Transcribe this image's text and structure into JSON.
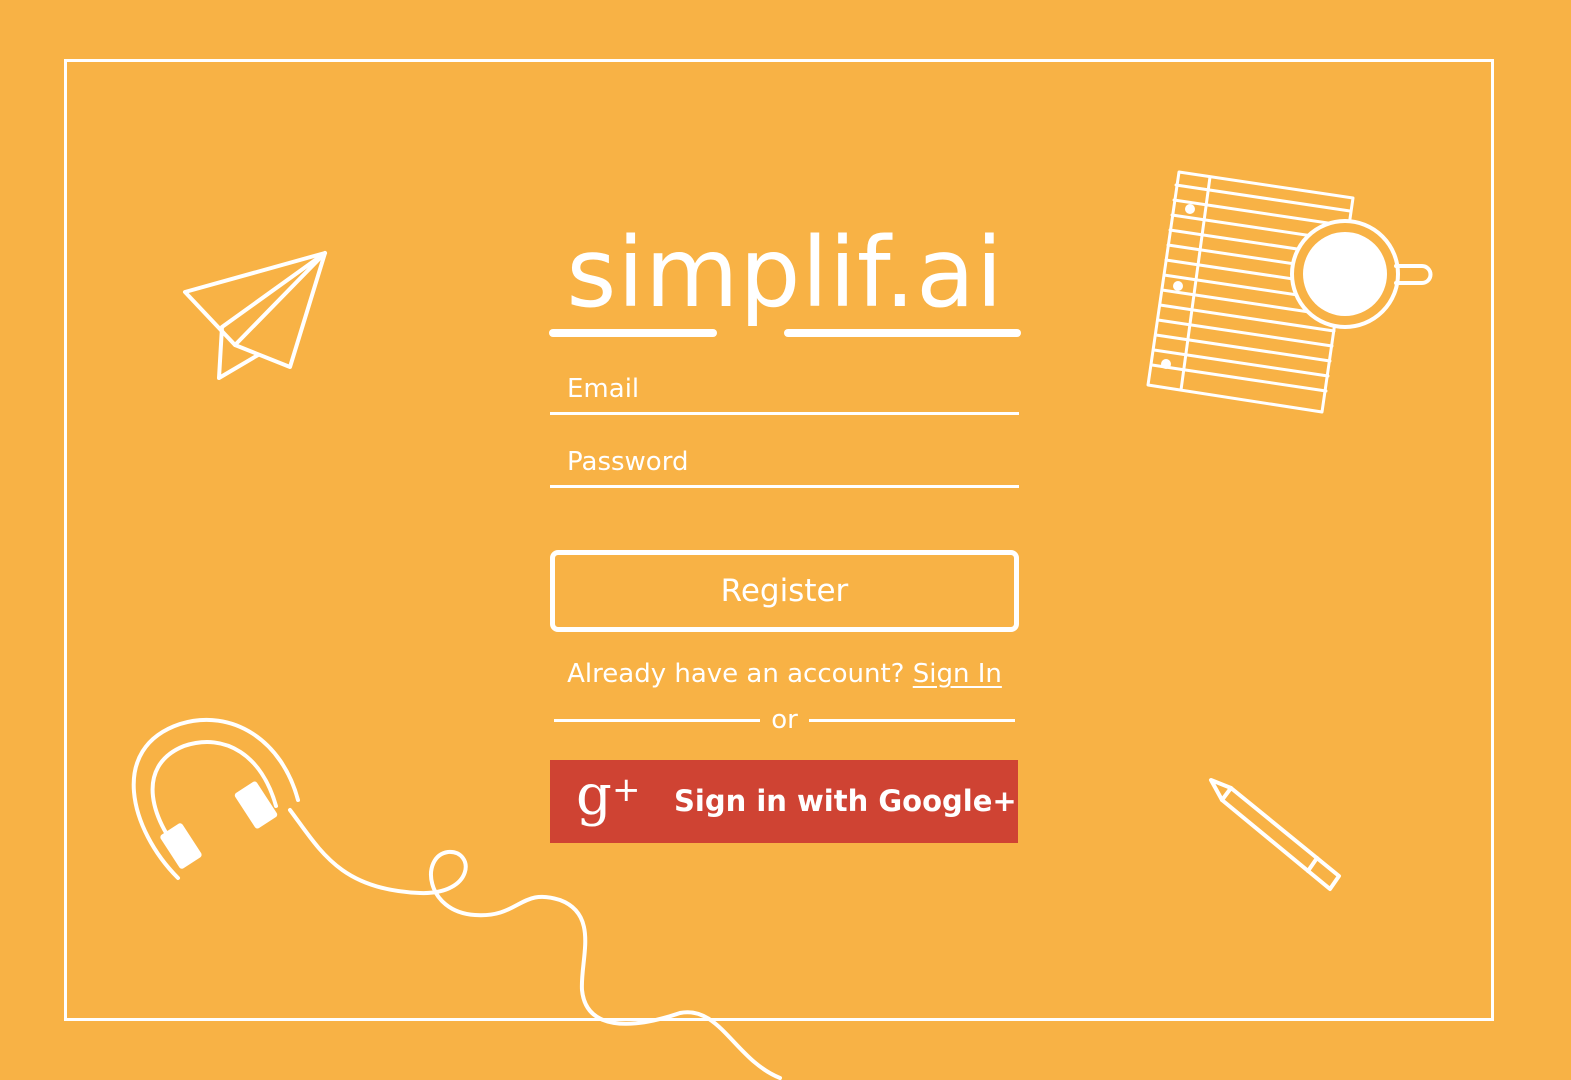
{
  "brand": {
    "logo_text": "simplif.ai"
  },
  "form": {
    "email_placeholder": "Email",
    "password_placeholder": "Password",
    "register_label": "Register",
    "already_text": "Already have an account?",
    "sign_in_link": "Sign In",
    "divider_text": "or",
    "google_icon_glyph": "g",
    "google_icon_plus": "+",
    "google_label": "Sign in with Google+"
  },
  "decorations": {
    "icons": [
      "paper-plane-icon",
      "notepad-coffee-icon",
      "headphones-icon",
      "pencil-icon"
    ]
  },
  "colors": {
    "background": "#F8B245",
    "foreground": "#FFFFFF",
    "google_button": "#CF4333"
  }
}
